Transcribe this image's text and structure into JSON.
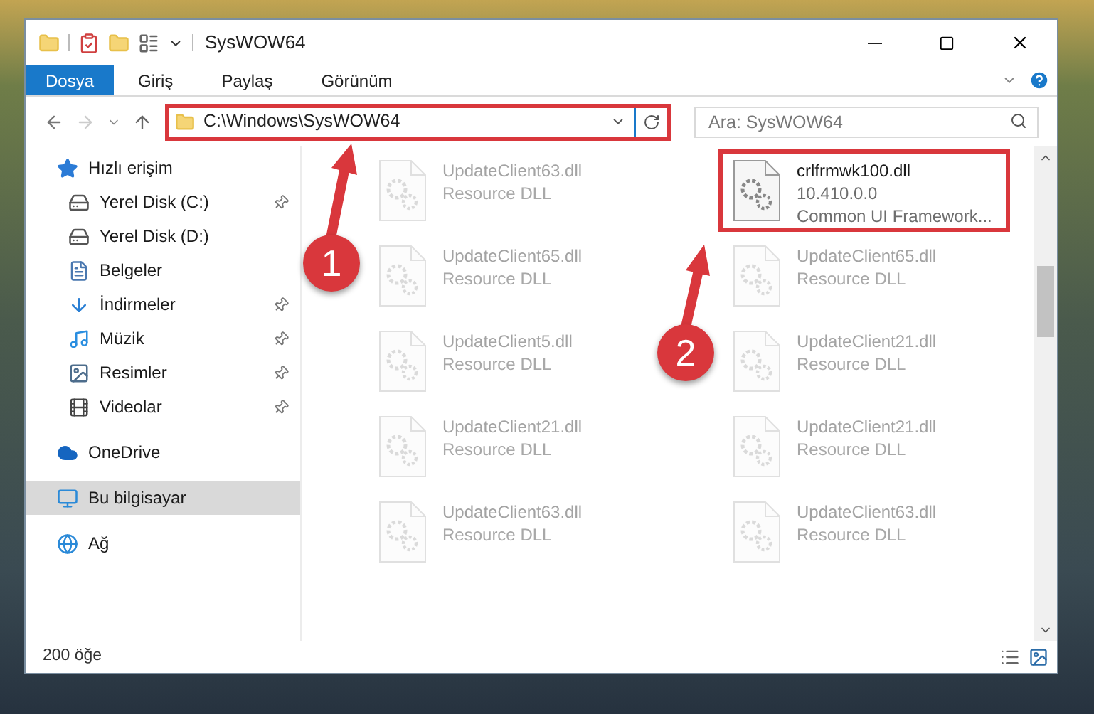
{
  "window": {
    "title": "SysWOW64"
  },
  "ribbon_tabs": [
    {
      "label": "Dosya",
      "selected": true
    },
    {
      "label": "Giriş",
      "selected": false
    },
    {
      "label": "Paylaş",
      "selected": false
    },
    {
      "label": "Görünüm",
      "selected": false
    }
  ],
  "address_bar": {
    "path": "C:\\Windows\\SysWOW64",
    "highlighted": true
  },
  "search": {
    "placeholder": "Ara: SysWOW64"
  },
  "nav": [
    {
      "label": "Hızlı erişim",
      "kind": "quick",
      "selected": false,
      "children": [
        {
          "label": "Yerel Disk (C:)",
          "kind": "drive",
          "pinned": true
        },
        {
          "label": "Yerel Disk (D:)",
          "kind": "drive",
          "pinned": false
        },
        {
          "label": "Belgeler",
          "kind": "documents",
          "pinned": false
        },
        {
          "label": "İndirmeler",
          "kind": "downloads",
          "pinned": true
        },
        {
          "label": "Müzik",
          "kind": "music",
          "pinned": true
        },
        {
          "label": "Resimler",
          "kind": "pictures",
          "pinned": true
        },
        {
          "label": "Videolar",
          "kind": "videos",
          "pinned": true
        }
      ]
    },
    {
      "label": "OneDrive",
      "kind": "cloud",
      "selected": false
    },
    {
      "label": "Bu bilgisayar",
      "kind": "computer",
      "selected": true
    },
    {
      "label": "Ağ",
      "kind": "network",
      "selected": false
    }
  ],
  "files": [
    {
      "name": "UpdateClient63.dll",
      "description": "Resource DLL",
      "faded": true,
      "highlighted": false
    },
    {
      "name": "crlfrmwk100.dll",
      "version": "10.410.0.0",
      "description": "Common UI Framework...",
      "faded": false,
      "highlighted": true
    },
    {
      "name": "UpdateClient65.dll",
      "description": "Resource DLL",
      "faded": true,
      "highlighted": false
    },
    {
      "name": "UpdateClient65.dll",
      "description": "Resource DLL",
      "faded": true,
      "highlighted": false
    },
    {
      "name": "UpdateClient5.dll",
      "description": "Resource DLL",
      "faded": true,
      "highlighted": false
    },
    {
      "name": "UpdateClient21.dll",
      "description": "Resource DLL",
      "faded": true,
      "highlighted": false
    },
    {
      "name": "UpdateClient21.dll",
      "description": "Resource DLL",
      "faded": true,
      "highlighted": false
    },
    {
      "name": "UpdateClient21.dll",
      "description": "Resource DLL",
      "faded": true,
      "highlighted": false
    },
    {
      "name": "UpdateClient63.dll",
      "description": "Resource DLL",
      "faded": true,
      "highlighted": false
    },
    {
      "name": "UpdateClient63.dll",
      "description": "Resource DLL",
      "faded": true,
      "highlighted": false
    }
  ],
  "annotations": [
    {
      "number": "1"
    },
    {
      "number": "2"
    }
  ],
  "status_bar": {
    "item_count": "200 öğe"
  }
}
